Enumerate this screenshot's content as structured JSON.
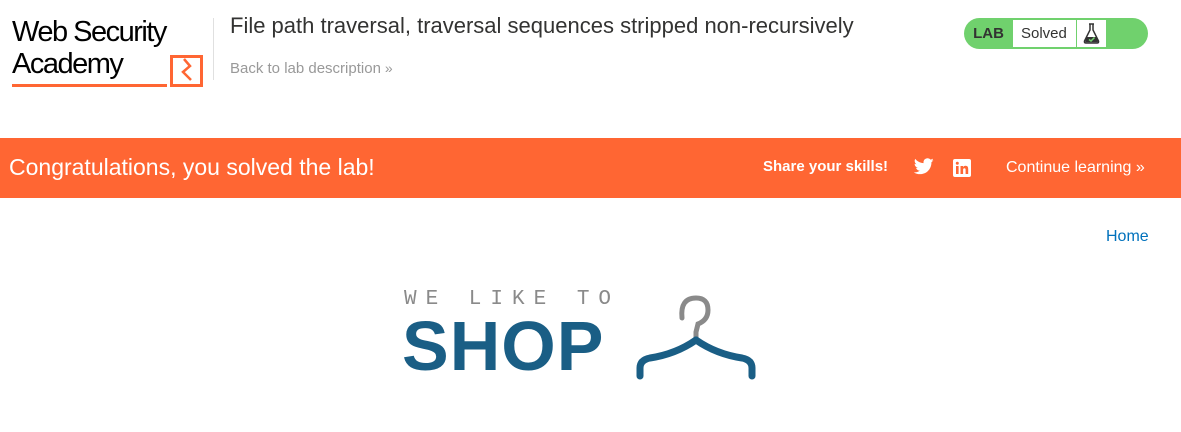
{
  "header": {
    "logo_line1": "Web Security",
    "logo_line2": "Academy",
    "lab_title": "File path traversal, traversal sequences stripped non-recursively",
    "back_link": "Back to lab description",
    "back_chevron": "»"
  },
  "lab_status": {
    "badge": "LAB",
    "status": "Solved",
    "icon": "flask-icon",
    "color": "#70d16d"
  },
  "banner": {
    "message": "Congratulations, you solved the lab!",
    "share_label": "Share your skills!",
    "twitter_icon": "twitter-icon",
    "linkedin_icon": "linkedin-icon",
    "continue_label": "Continue learning »",
    "color": "#ff6633"
  },
  "nav": {
    "home": "Home"
  },
  "shop_logo": {
    "tagline": "WE LIKE TO",
    "word": "SHOP",
    "icon": "hanger-icon",
    "color": "#1a5e85"
  }
}
